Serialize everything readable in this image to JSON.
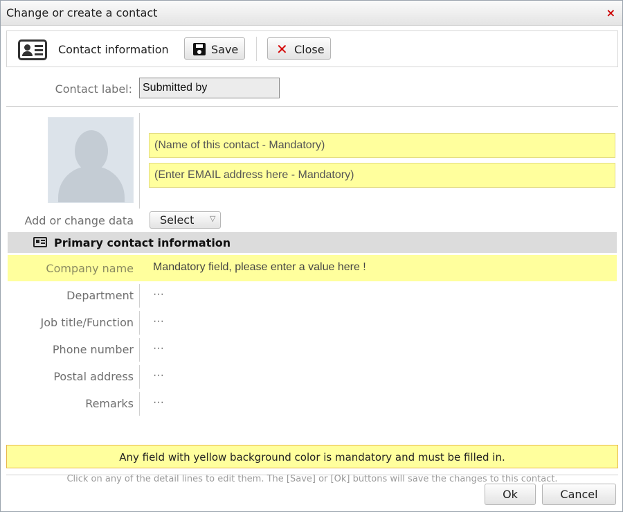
{
  "window": {
    "title": "Change or create a contact",
    "close_glyph": "×"
  },
  "toolbar": {
    "section_label": "Contact information",
    "save_label": "Save",
    "close_label": "Close",
    "close_glyph": "✕"
  },
  "contact_label": {
    "label": "Contact label:",
    "value": "Submitted by"
  },
  "contact_fields": {
    "name_placeholder": "(Name of this contact - Mandatory)",
    "email_placeholder": "(Enter EMAIL address here - Mandatory)"
  },
  "add_data": {
    "label": "Add or change data",
    "select_label": "Select",
    "select_arrow": "▽"
  },
  "section": {
    "title": "Primary contact information"
  },
  "rows": [
    {
      "label": "Company name",
      "value": "Mandatory field, please enter a value here !",
      "mandatory": true
    },
    {
      "label": "Department",
      "value": "···",
      "mandatory": false
    },
    {
      "label": "Job title/Function",
      "value": "···",
      "mandatory": false
    },
    {
      "label": "Phone number",
      "value": "···",
      "mandatory": false
    },
    {
      "label": "Postal address",
      "value": "···",
      "mandatory": false
    },
    {
      "label": "Remarks",
      "value": "···",
      "mandatory": false
    }
  ],
  "notice": "Any field with yellow background color is mandatory and must be filled in.",
  "hint": "Click on any of the detail lines to edit them. The [Save] or [Ok] buttons will save the changes to this contact.",
  "footer": {
    "ok_label": "Ok",
    "cancel_label": "Cancel"
  },
  "colors": {
    "mandatory_bg": "#ffff9d",
    "close_red": "#cc0000",
    "section_bg": "#dcdcdc"
  }
}
